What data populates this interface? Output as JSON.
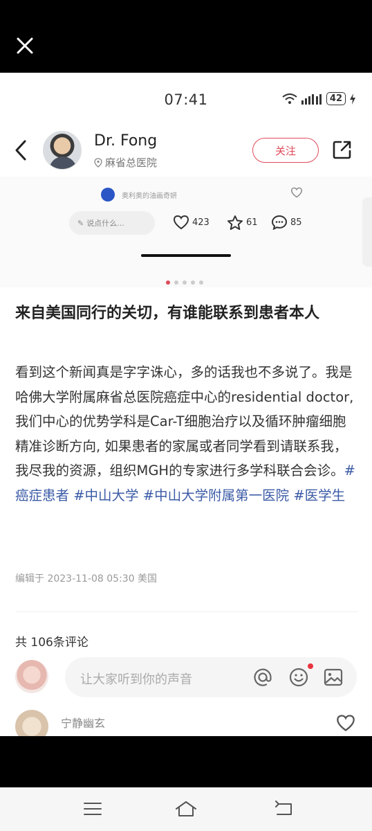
{
  "viewer": {
    "close_icon": "close-icon"
  },
  "status_bar": {
    "time": "07:41",
    "battery": "42"
  },
  "header": {
    "author_name": "Dr. Fong",
    "location": "麻省总医院",
    "follow_label": "关注"
  },
  "carousel": {
    "inner_comment_text": "奥利奥的油画奇妍",
    "say_placeholder": "说点什么...",
    "likes": "423",
    "stars": "61",
    "comments": "85",
    "dots_count": 5,
    "active_dot": 0
  },
  "post": {
    "title": "来自美国同行的关切，有谁能联系到患者本人",
    "body": "看到这个新闻真是字字诛心，多的话我也不多说了。我是哈佛大学附属麻省总医院癌症中心的residential doctor, 我们中心的优势学科是Car-T细胞治疗以及循环肿瘤细胞精准诊断方向, 如果患者的家属或者同学看到请联系我，我尽我的资源，组织MGH的专家进行多学科联合会诊。",
    "tags": [
      "#癌症患者",
      "#中山大学",
      "#中山大学附属第一医院",
      "#医学生"
    ],
    "edited": "编辑于 2023-11-08 05:30 美国"
  },
  "comments": {
    "count_label": "共 106条评论",
    "input_placeholder": "让大家听到你的声音",
    "first_commenter": "宁静幽玄"
  },
  "colors": {
    "accent": "#e04a5a",
    "tag": "#3b5ba6"
  }
}
